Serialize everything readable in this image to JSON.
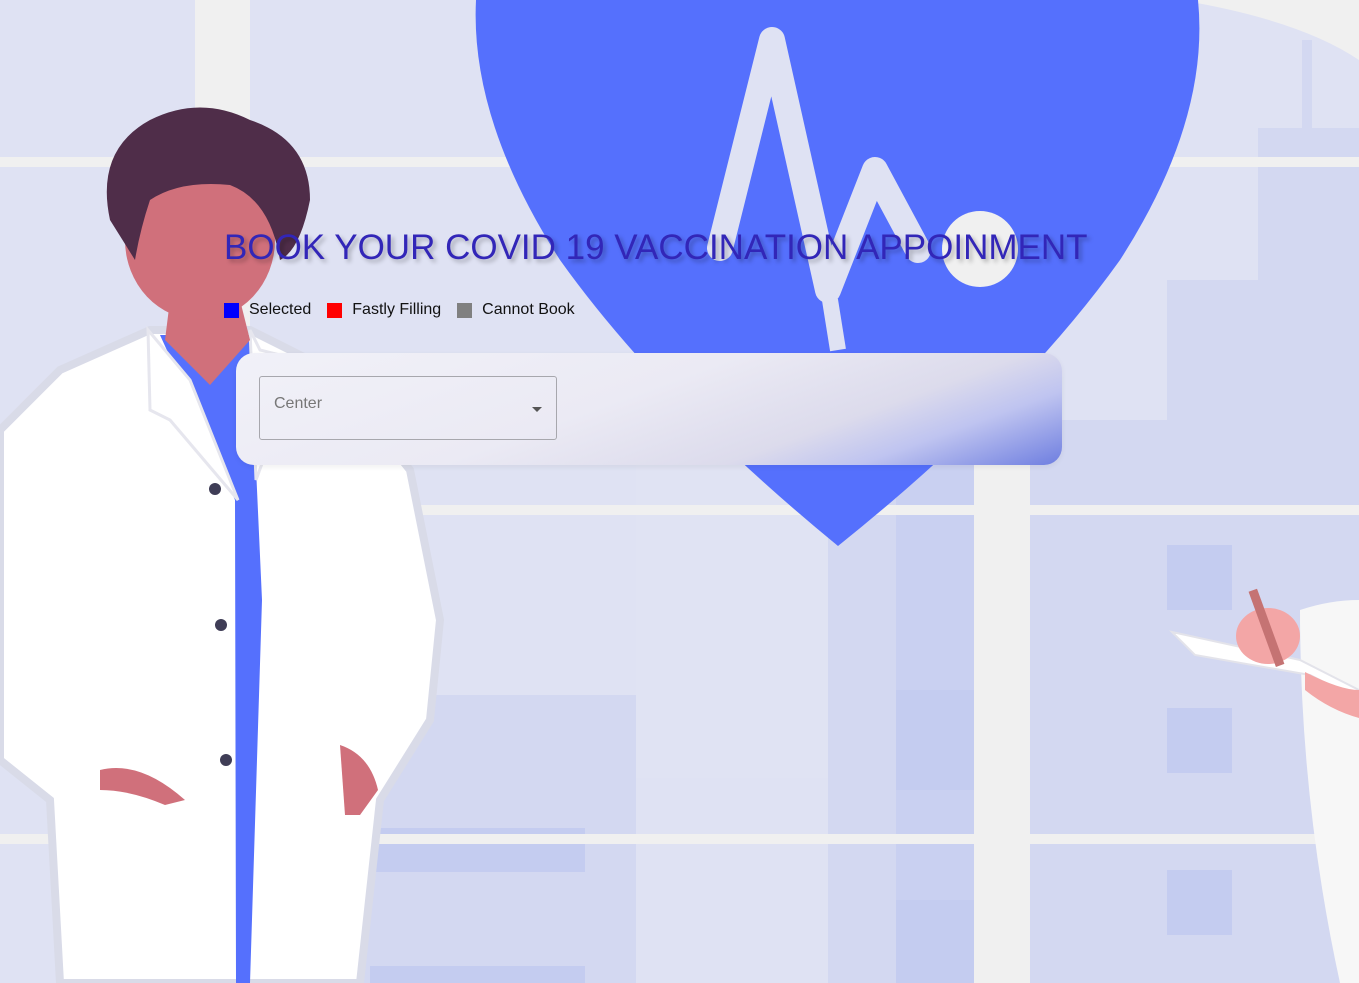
{
  "page": {
    "title": "BOOK YOUR COVID 19 VACCINATION APPOINMENT"
  },
  "legend": [
    {
      "label": "Selected",
      "color": "#0000ff"
    },
    {
      "label": "Fastly Filling",
      "color": "#ff0000"
    },
    {
      "label": "Cannot Book",
      "color": "#808080"
    }
  ],
  "form": {
    "center_select": {
      "placeholder": "Center",
      "icon": "chevron-down-icon"
    }
  },
  "colors": {
    "heart": "#5570fd",
    "title": "#3226b8",
    "background": "#dfe2f3"
  }
}
